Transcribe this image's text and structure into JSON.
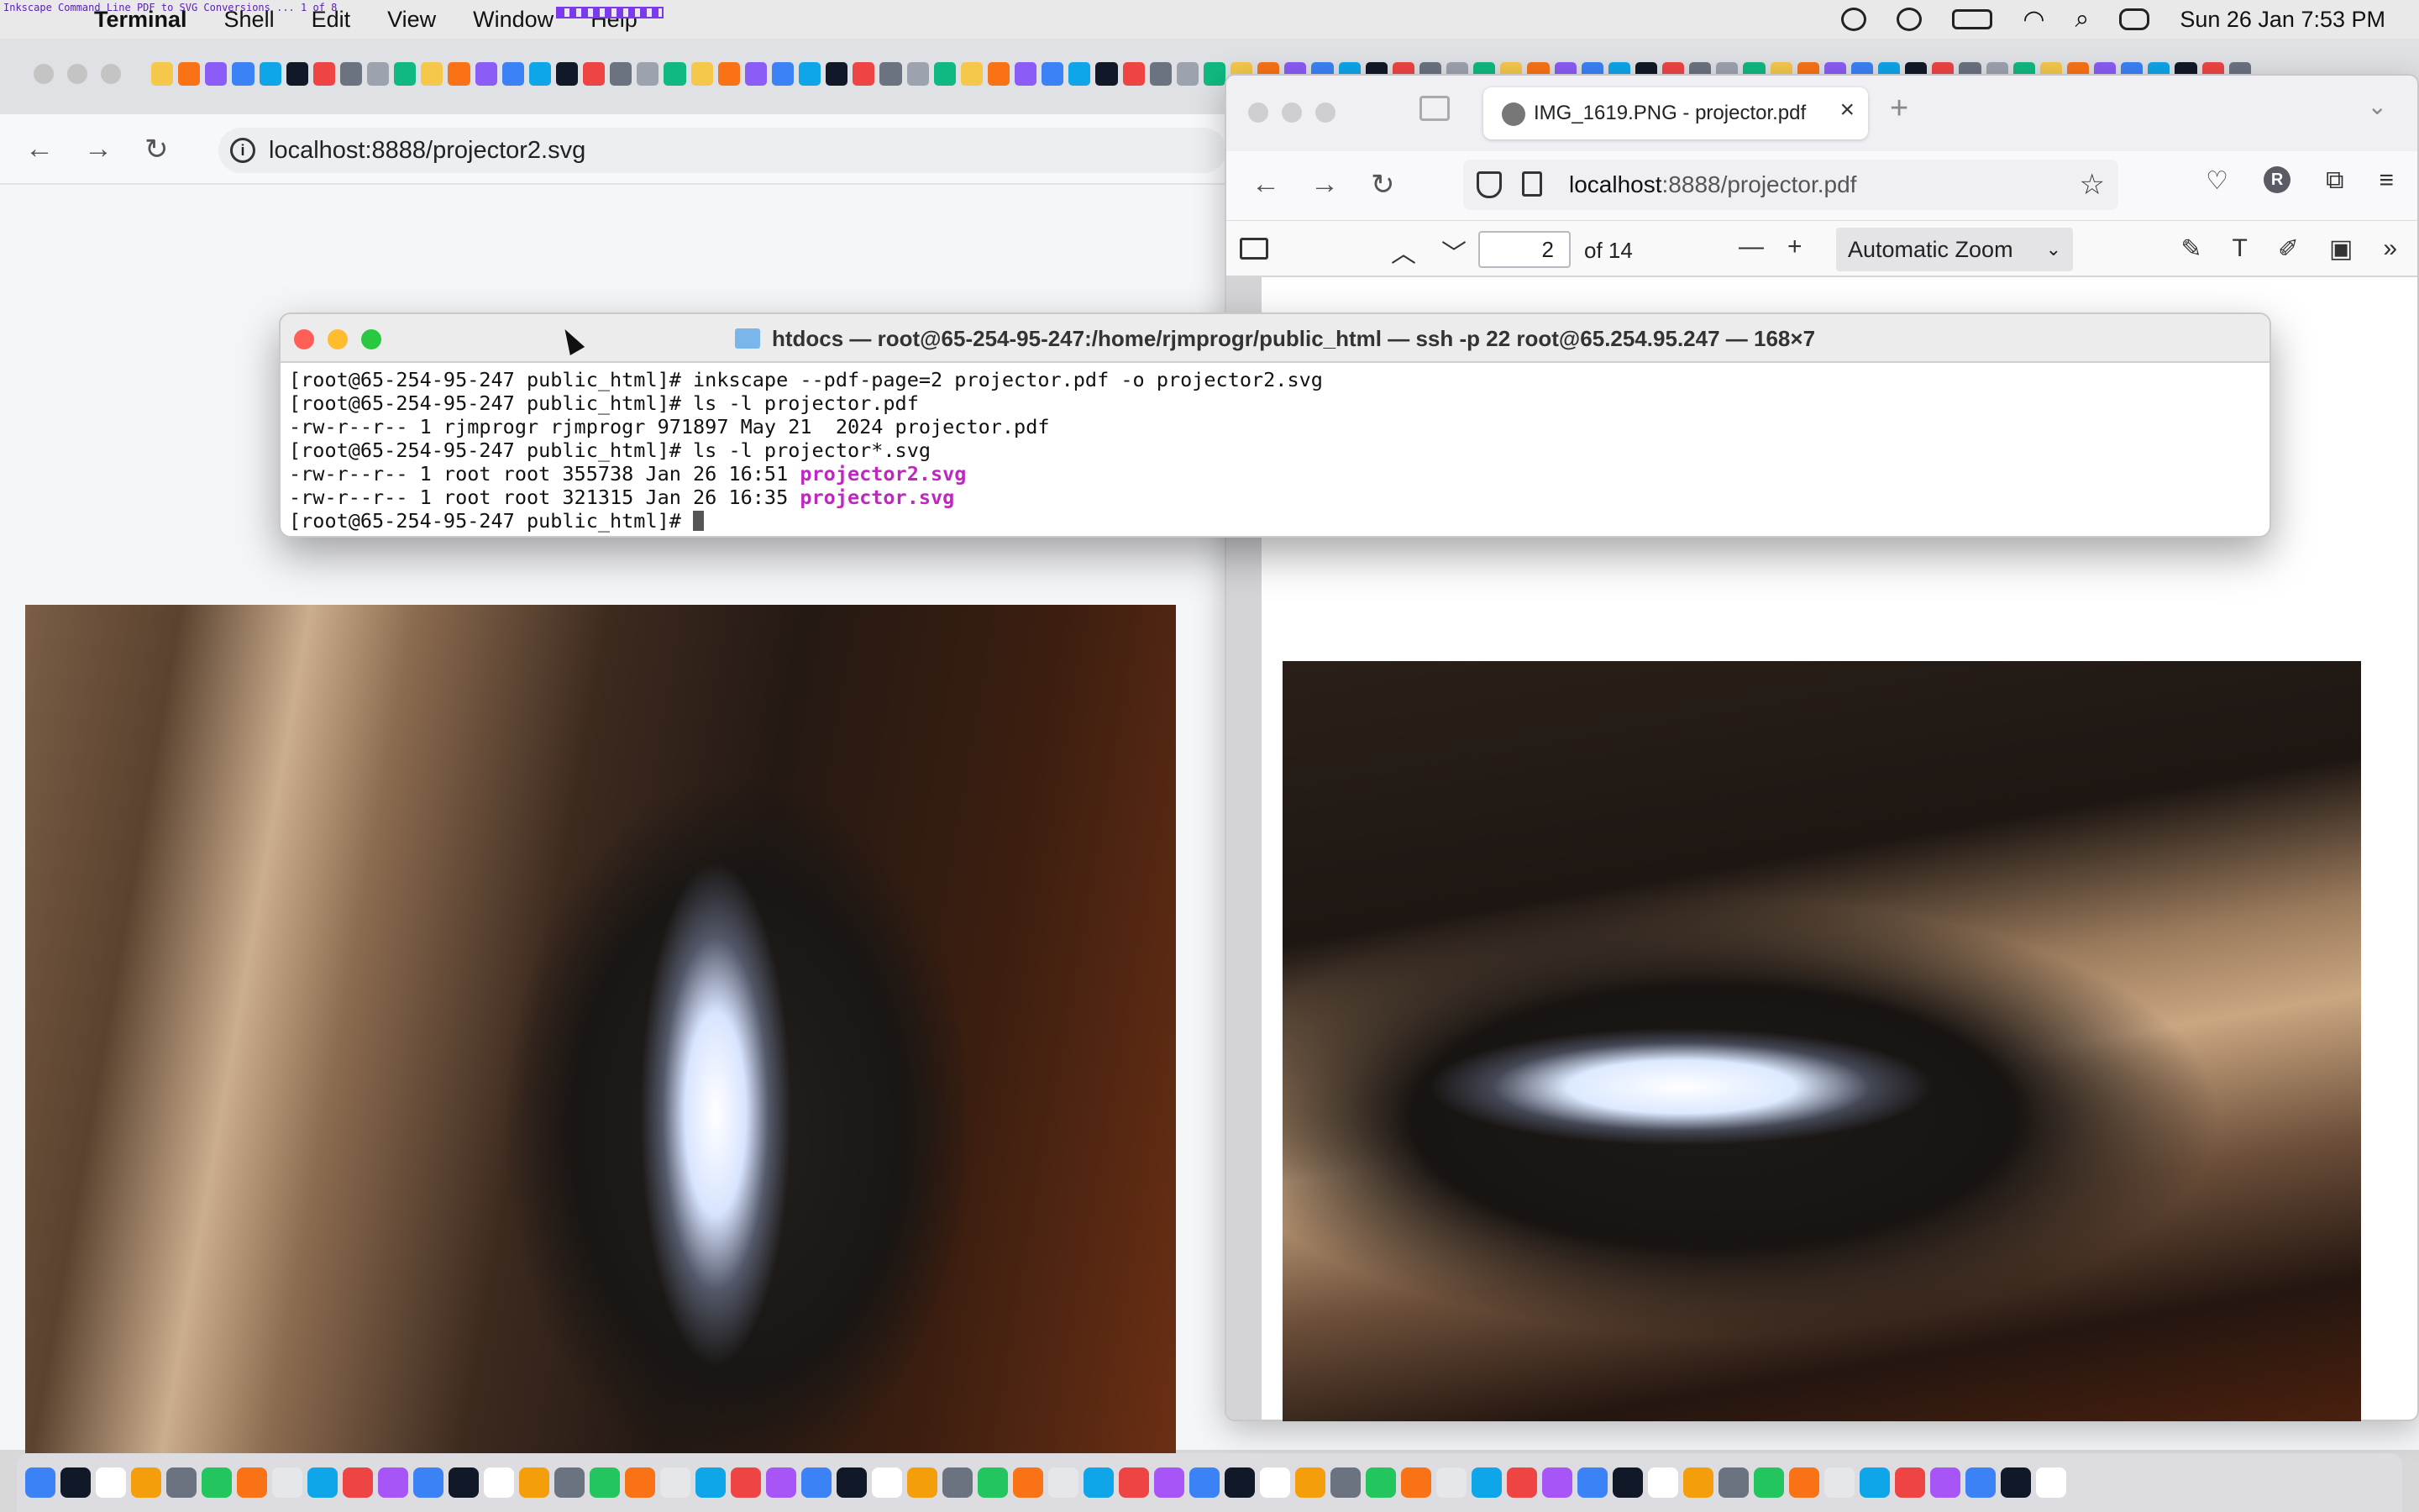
{
  "menubar": {
    "tiny_window_title": "Inkscape Command Line PDF to SVG Conversions ... 1 of 8",
    "app_name": "Terminal",
    "items": [
      "Shell",
      "Edit",
      "View",
      "Window",
      "Help"
    ],
    "clock": "Sun 26 Jan  7:53 PM"
  },
  "chrome": {
    "url": "localhost:8888/projector2.svg"
  },
  "firefox": {
    "tab_title": "IMG_1619.PNG - projector.pdf",
    "url_host": "localhost",
    "url_rest": ":8888/projector.pdf",
    "avatar_letter": "R",
    "pdf": {
      "page_number": "2",
      "page_total": "of 14",
      "zoom": "Automatic Zoom"
    }
  },
  "terminal": {
    "title": "htdocs — root@65-254-95-247:/home/rjmprogr/public_html — ssh -p 22 root@65.254.95.247 — 168×7",
    "lines": {
      "l1": "[root@65-254-95-247 public_html]# inkscape --pdf-page=2 projector.pdf -o projector2.svg",
      "l2": "[root@65-254-95-247 public_html]# ls -l projector.pdf",
      "l3": "-rw-r--r-- 1 rjmprogr rjmprogr 971897 May 21  2024 projector.pdf",
      "l4": "[root@65-254-95-247 public_html]# ls -l projector*.svg",
      "l5_prefix": "-rw-r--r-- 1 root root 355738 Jan 26 16:51 ",
      "l5_file": "projector2.svg",
      "l6_prefix": "-rw-r--r-- 1 root root 321315 Jan 26 16:35 ",
      "l6_file": "projector.svg",
      "l7": "[root@65-254-95-247 public_html]# "
    }
  },
  "colors": {
    "close": "#ff5f57",
    "minimize": "#febc2e",
    "zoom": "#28c840",
    "magenta": "#c026c0"
  }
}
